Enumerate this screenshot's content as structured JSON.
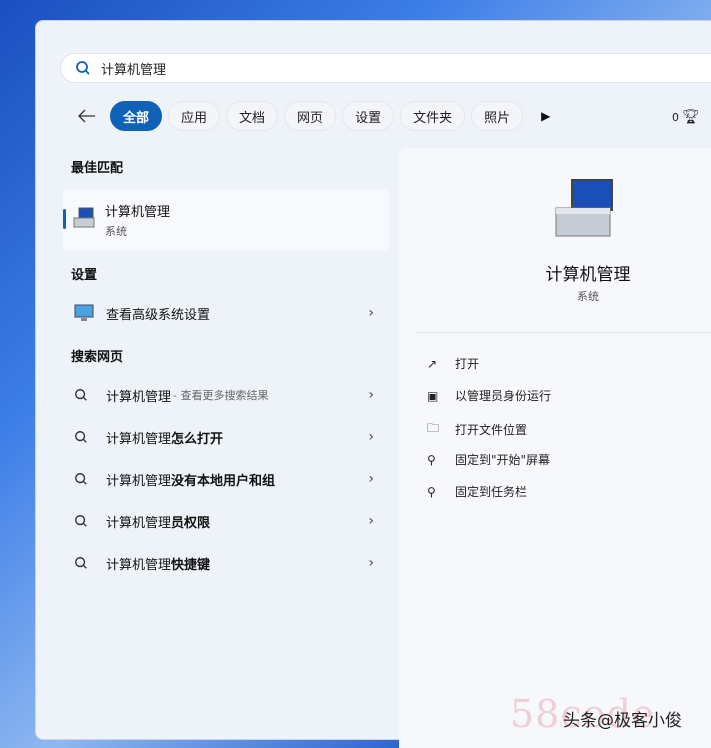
{
  "search": {
    "query": "计算机管理"
  },
  "filters": [
    {
      "label": "全部",
      "active": true
    },
    {
      "label": "应用"
    },
    {
      "label": "文档"
    },
    {
      "label": "网页"
    },
    {
      "label": "设置"
    },
    {
      "label": "文件夹"
    },
    {
      "label": "照片"
    }
  ],
  "rewards_points": "0",
  "sections": {
    "best": "最佳匹配",
    "settings": "设置",
    "web": "搜索网页"
  },
  "best_match": {
    "title": "计算机管理",
    "subtitle": "系统"
  },
  "settings_items": [
    {
      "label": "查看高级系统设置"
    }
  ],
  "web_items": [
    {
      "prefix": "计算机管理",
      "suffix": " - 查看更多搜索结果",
      "bold": ""
    },
    {
      "prefix": "计算机管理",
      "bold": "怎么打开"
    },
    {
      "prefix": "计算机管理",
      "bold": "没有本地用户和组"
    },
    {
      "prefix": "计算机管理",
      "bold": "员权限"
    },
    {
      "prefix": "计算机管理",
      "bold": "快捷键"
    }
  ],
  "detail": {
    "title": "计算机管理",
    "subtitle": "系统",
    "actions": [
      {
        "label": "打开",
        "icon": "open-external-icon"
      },
      {
        "label": "以管理员身份运行",
        "icon": "shield-admin-icon"
      },
      {
        "label": "打开文件位置",
        "icon": "folder-icon"
      },
      {
        "label": "固定到\"开始\"屏幕",
        "icon": "pin-icon"
      },
      {
        "label": "固定到任务栏",
        "icon": "pin-icon"
      }
    ]
  },
  "watermark": {
    "site": "58code",
    "credit": "头条@极客小俊"
  }
}
